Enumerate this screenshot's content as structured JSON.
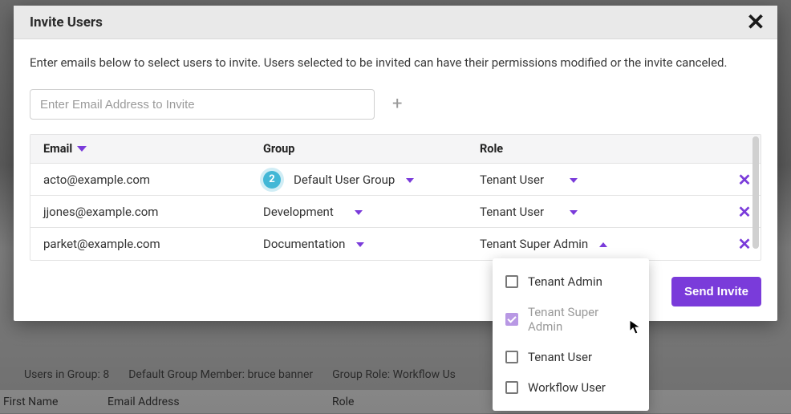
{
  "colors": {
    "accent": "#7a3bda",
    "badge": "#42b7d6"
  },
  "backdrop": {
    "info": {
      "users_in_group": "Users in Group: 8",
      "default_member": "Default Group Member: bruce banner",
      "group_role": "Group Role: Workflow Us"
    },
    "cols": {
      "first_name": "First Name",
      "email": "Email Address",
      "role": "Role"
    }
  },
  "modal": {
    "title": "Invite Users",
    "description": "Enter emails below to select users to invite. Users selected to be invited can have their permissions modified or the invite canceled.",
    "email_input": {
      "value": "",
      "placeholder": "Enter Email Address to Invite"
    },
    "add_icon_label": "+",
    "columns": {
      "email": "Email",
      "group": "Group",
      "role": "Role"
    },
    "rows": [
      {
        "email": "acto@example.com",
        "badge": "2",
        "group": "Default User Group",
        "role": "Tenant User",
        "role_open": false
      },
      {
        "email": "jjones@example.com",
        "badge": "",
        "group": "Development",
        "role": "Tenant User",
        "role_open": false
      },
      {
        "email": "parket@example.com",
        "badge": "",
        "group": "Documentation",
        "role": "Tenant Super Admin",
        "role_open": true
      }
    ],
    "send_label": "Send Invite",
    "role_options": [
      {
        "label": "Tenant Admin",
        "checked": false
      },
      {
        "label": "Tenant Super Admin",
        "checked": true
      },
      {
        "label": "Tenant User",
        "checked": false
      },
      {
        "label": "Workflow User",
        "checked": false
      }
    ]
  }
}
